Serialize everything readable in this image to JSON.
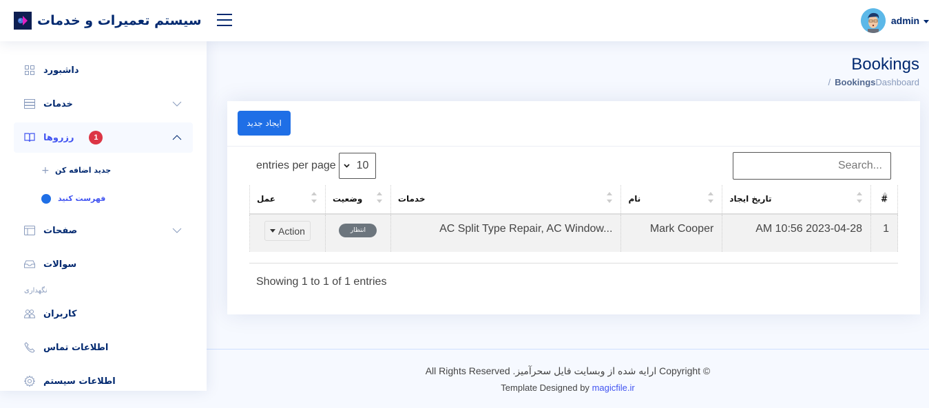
{
  "header": {
    "app_title": "سیستم تعمیرات و خدمات",
    "profile_name": "admin"
  },
  "sidebar": {
    "items": [
      {
        "label": "داشبورد",
        "icon": "grid-icon"
      },
      {
        "label": "خدمات",
        "icon": "server-icon",
        "expandable": true
      },
      {
        "label": "رزروها",
        "icon": "book-icon",
        "badge": "1",
        "expanded": true,
        "active": true,
        "children": [
          {
            "label": "جدید اضافه کن",
            "icon": "plus-icon"
          },
          {
            "label": "فهرست کنید",
            "icon": "circle-icon",
            "active": true
          }
        ]
      },
      {
        "label": "صفحات",
        "icon": "layout-icon",
        "expandable": true
      },
      {
        "label": "سوالات",
        "icon": "inbox-icon"
      }
    ],
    "section_heading": "نگهداری",
    "maintenance_items": [
      {
        "label": "کاربران",
        "icon": "people-icon"
      },
      {
        "label": "اطلاعات تماس",
        "icon": "phone-icon"
      },
      {
        "label": "اطلاعات سیستم",
        "icon": "gear-icon"
      }
    ]
  },
  "page": {
    "title": "Bookings",
    "breadcrumb": {
      "separator": "/",
      "current": "Bookings",
      "home": "Dashboard"
    }
  },
  "card": {
    "create_button": "ایجاد جدید",
    "per_page_label": "entries per page",
    "per_page_value": "10",
    "search_placeholder": "Search...",
    "table": {
      "columns": [
        "#",
        "تاریخ ایجاد",
        "نام",
        "خدمات",
        "وضعیت",
        "عمل"
      ],
      "rows": [
        {
          "index": "1",
          "created": "2023-04-28 10:56 AM",
          "name": "Mark Cooper",
          "services": "AC Split Type Repair, AC Window...",
          "status": "انتظار",
          "action": "Action"
        }
      ]
    },
    "info": "Showing 1 to 1 of 1 entries"
  },
  "footer": {
    "copyright": "© Copyright ارایه شده از وبسایت فایل سحرآمیز. All Rights Reserved",
    "credits_prefix": "Template Designed by",
    "credits_link": "magicfile.ir"
  },
  "colors": {
    "primary": "#1f6fe6",
    "navy": "#012970",
    "badge_danger": "#dc3545",
    "status_secondary": "#6c757d"
  }
}
